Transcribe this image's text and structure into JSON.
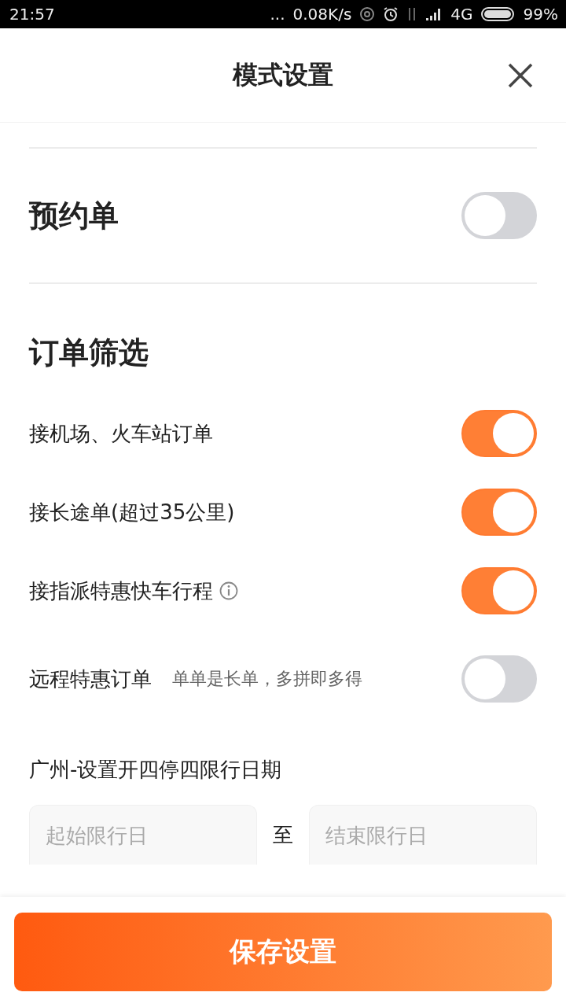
{
  "status_bar": {
    "time": "21:57",
    "more": "...",
    "speed": "0.08K/s",
    "network": "4G",
    "battery": "99%"
  },
  "header": {
    "title": "模式设置"
  },
  "reservation": {
    "label": "预约单",
    "on": false
  },
  "filter": {
    "title": "订单筛选",
    "rows": [
      {
        "label": "接机场、火车站订单",
        "on": true,
        "info": false
      },
      {
        "label": "接长途单(超过35公里)",
        "on": true,
        "info": false
      },
      {
        "label": "接指派特惠快车行程",
        "on": true,
        "info": true
      },
      {
        "label": "远程特惠订单",
        "subtitle": "单单是长单，多拼即多得",
        "on": false,
        "info": false
      }
    ]
  },
  "restriction": {
    "label": "广州-设置开四停四限行日期",
    "start_placeholder": "起始限行日",
    "separator": "至",
    "end_placeholder": "结束限行日"
  },
  "save_button": "保存设置"
}
